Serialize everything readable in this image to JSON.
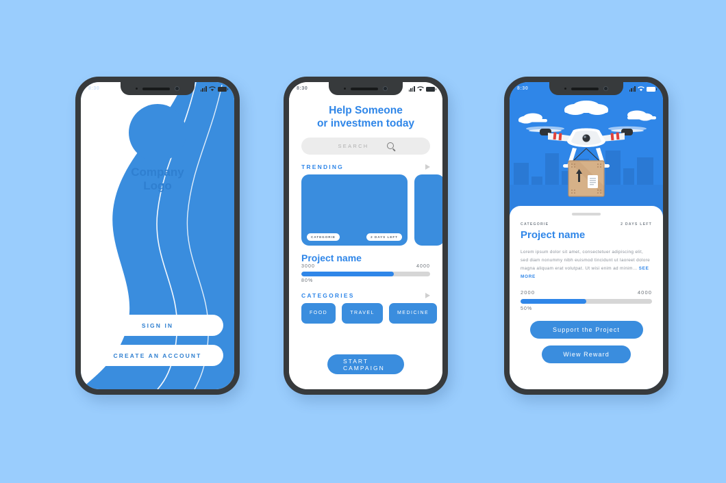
{
  "canvas": {
    "background_color": "#9acdfd",
    "primary_blue": "#3a8dde",
    "accent_blue": "#2f86e8",
    "frame_color": "#373a3c"
  },
  "status_bar": {
    "time": "8:30",
    "icons": [
      "signal-icon",
      "wifi-icon",
      "battery-icon"
    ]
  },
  "screen_onboarding": {
    "logo_line_1": "Company",
    "logo_line_2": "Logo",
    "sign_in_label": "SIGN IN",
    "create_account_label": "CREATE AN ACCOUNT"
  },
  "screen_home": {
    "title_line_1": "Help Someone",
    "title_line_2": "or investmen today",
    "search_placeholder": "SEARCH",
    "trending_label": "TRENDING",
    "card_category_tag": "CATEGORIE",
    "card_days_tag": "2 DAYS LEFT",
    "project_name": "Project name",
    "amount_current": "3000",
    "amount_goal": "4000",
    "percent_label": "80%",
    "progress_fill": 72,
    "categories_label": "CATEGORIES",
    "chips": [
      "FOOD",
      "TRAVEL",
      "MEDICINE"
    ],
    "cta_label": "START CAMPAIGN"
  },
  "screen_detail": {
    "category": "CATEGORIE",
    "days_left": "2 DAYS LEFT",
    "project_name": "Project name",
    "description": "Lorem ipsum dolor sit amet, consectetuer adipiscing elit, sed diam nonummy nibh euismod tincidunt ut laoreet dolore magna aliquam erat volutpat. Ut wisi enim ad minim…",
    "see_more_label": "SEE MORE",
    "amount_current": "2000",
    "amount_goal": "4000",
    "percent_label": "50%",
    "progress_fill": 50,
    "support_button_label": "Support the Project",
    "reward_button_label": "Wiew Reward",
    "illustration": "drone-delivering-package-over-city"
  }
}
